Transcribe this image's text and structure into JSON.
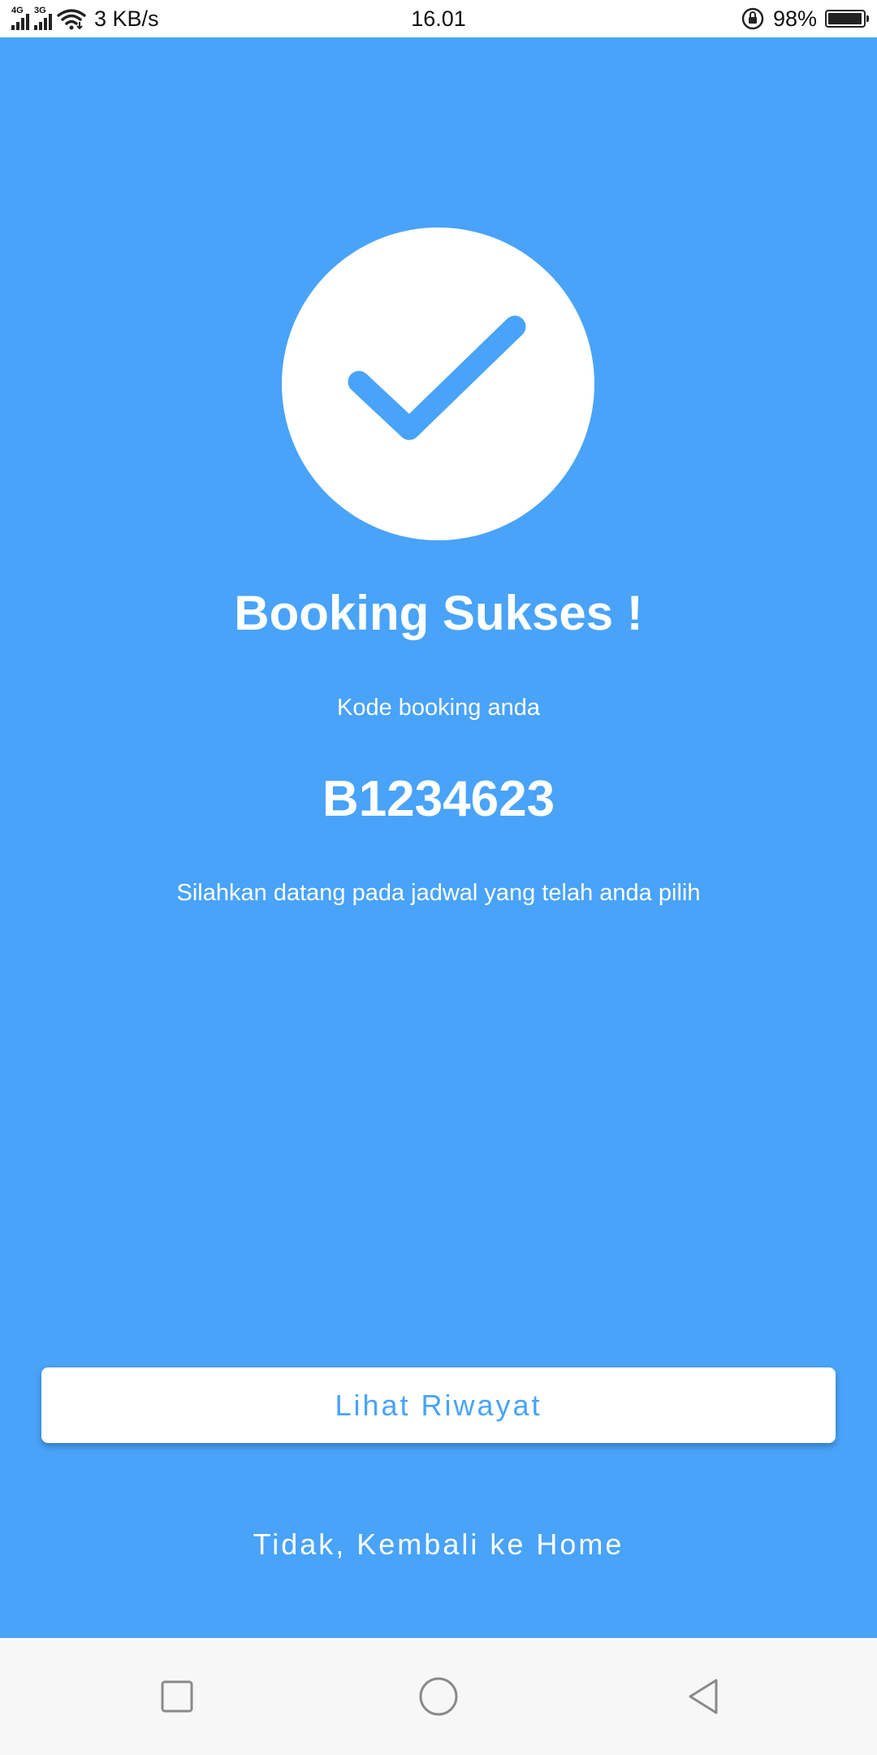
{
  "status_bar": {
    "net1": "4G",
    "net2": "3G",
    "speed": "3 KB/s",
    "time": "16.01",
    "battery": "98%",
    "battery_level": 0.98
  },
  "success": {
    "title": "Booking Sukses !",
    "code_label": "Kode booking anda",
    "code": "B1234623",
    "note": "Silahkan datang pada jadwal yang telah anda pilih"
  },
  "actions": {
    "history_label": "Lihat Riwayat",
    "home_label": "Tidak, Kembali ke Home"
  },
  "colors": {
    "primary": "#48A3F9",
    "surface": "#FFFFFF",
    "nav_bg": "#F7F7F7"
  }
}
